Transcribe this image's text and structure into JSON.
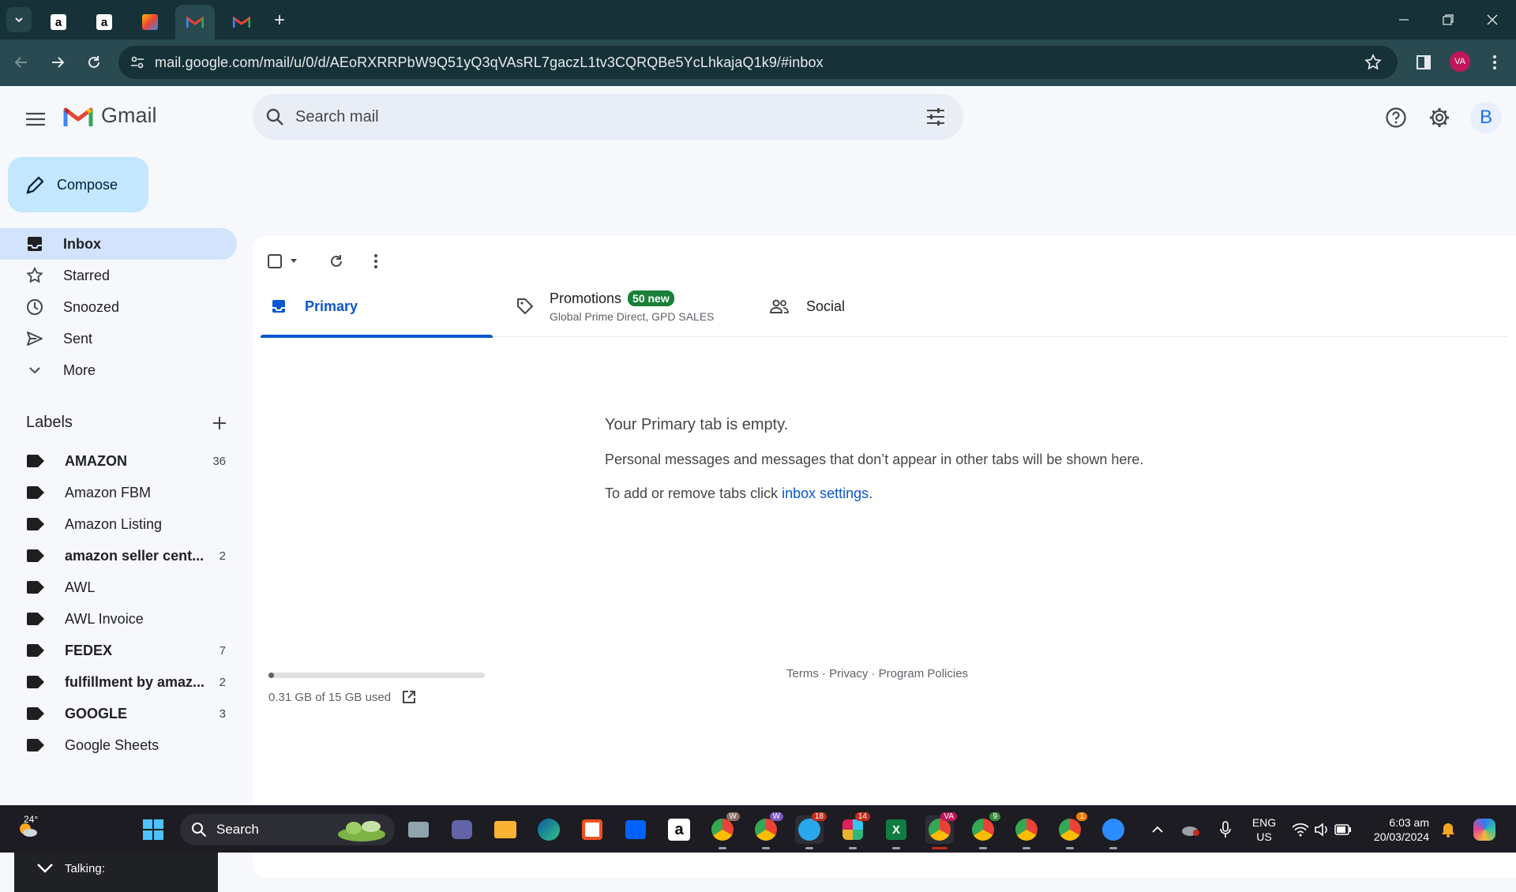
{
  "browser": {
    "url": "mail.google.com/mail/u/0/d/AEoRXRRPbW9Q51yQ3qVAsRL7gaczL1tv3CQRQBe5YcLhkajaQ1k9/#inbox",
    "profile_initials": "VA"
  },
  "header": {
    "app_name": "Gmail",
    "search_placeholder": "Search mail",
    "account_initial": "B"
  },
  "sidebar": {
    "compose_label": "Compose",
    "nav": [
      {
        "label": "Inbox",
        "icon": "inbox-icon",
        "active": true
      },
      {
        "label": "Starred",
        "icon": "star-icon"
      },
      {
        "label": "Snoozed",
        "icon": "clock-icon"
      },
      {
        "label": "Sent",
        "icon": "send-icon"
      },
      {
        "label": "More",
        "icon": "chevron-down-icon"
      }
    ],
    "labels_heading": "Labels",
    "labels": [
      {
        "name": "AMAZON",
        "count": "36",
        "bold": true
      },
      {
        "name": "Amazon FBM",
        "count": "",
        "bold": false
      },
      {
        "name": "Amazon Listing",
        "count": "",
        "bold": false
      },
      {
        "name": "amazon seller cent...",
        "count": "2",
        "bold": true
      },
      {
        "name": "AWL",
        "count": "",
        "bold": false
      },
      {
        "name": "AWL Invoice",
        "count": "",
        "bold": false
      },
      {
        "name": "FEDEX",
        "count": "7",
        "bold": true
      },
      {
        "name": "fulfillment by amaz...",
        "count": "2",
        "bold": true
      },
      {
        "name": "GOOGLE",
        "count": "3",
        "bold": true
      },
      {
        "name": "Google Sheets",
        "count": "",
        "bold": false
      }
    ],
    "talking_label": "Talking:"
  },
  "main": {
    "tabs": {
      "primary": "Primary",
      "promotions": "Promotions",
      "promotions_badge": "50 new",
      "promotions_sub": "Global Prime Direct, GPD SALES",
      "social": "Social"
    },
    "empty_title": "Your Primary tab is empty.",
    "empty_desc": "Personal messages and messages that don’t appear in other tabs will be shown here.",
    "empty_hint_prefix": "To add or remove tabs click ",
    "empty_hint_link": "inbox settings",
    "empty_hint_suffix": ".",
    "storage_used_text": "0.31 GB of 15 GB used",
    "storage_fraction": 0.021,
    "footer": "Terms · Privacy · Program Policies"
  },
  "taskbar": {
    "weather": "24°",
    "search_label": "Search",
    "badges": {
      "chrome1": "W",
      "chrome2": "W",
      "telegram": "18",
      "slack": "14",
      "chrome_va": "VA",
      "chrome3": "9",
      "chrome5": "1"
    },
    "lang": "ENG",
    "region": "US",
    "time": "6:03 am",
    "date": "20/03/2024"
  }
}
